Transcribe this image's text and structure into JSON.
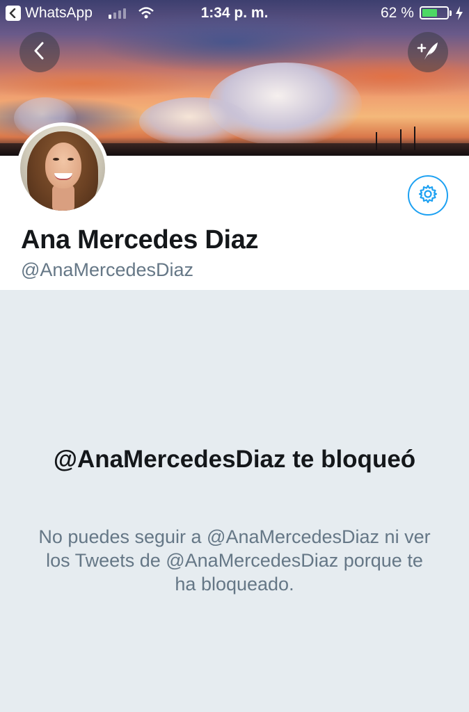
{
  "status_bar": {
    "back_app": "WhatsApp",
    "time": "1:34 p. m.",
    "battery_percent": "62 %",
    "battery_level": 0.62,
    "signal_bars_on": 1,
    "signal_bars_total": 4,
    "charging": true
  },
  "header": {
    "back_icon": "chevron-left-icon",
    "compose_icon": "compose-tweet-icon"
  },
  "profile": {
    "name": "Ana Mercedes Diaz",
    "handle": "@AnaMercedesDiaz",
    "settings_icon": "gear-icon"
  },
  "blocked": {
    "title": "@AnaMercedesDiaz te bloqueó",
    "message": "No puedes seguir a @AnaMercedesDiaz ni ver los Tweets de @AnaMercedesDiaz porque te ha bloqueado."
  },
  "colors": {
    "accent": "#1da1f2",
    "background": "#e6ecf0",
    "secondary_text": "#657786",
    "primary_text": "#14171a",
    "battery": "#4cd964"
  }
}
